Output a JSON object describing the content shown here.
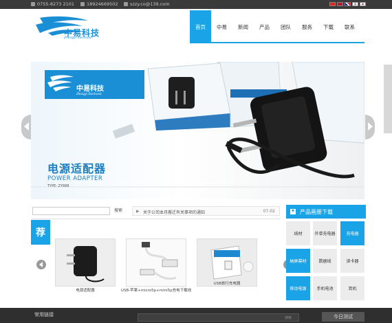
{
  "topbar": {
    "phone1": "0755-8273 2101",
    "phone2": "18924669502",
    "email": "szzy.co@139.com",
    "flags": [
      "cn-flag",
      "hk-flag",
      "uk-flag",
      "kr-flag",
      "jp-flag"
    ]
  },
  "logo": {
    "name": "中易科技",
    "sub": "Zhongyi Electronic"
  },
  "nav": {
    "items": [
      "首页",
      "中易",
      "新闻",
      "产品",
      "团队",
      "服务",
      "下载",
      "联系"
    ],
    "active_index": 0
  },
  "banner": {
    "logo_name": "中易科技",
    "logo_sub": "Zhongyi Electronic",
    "title": "电源适配器",
    "subtitle": "POWER ADAPTER",
    "type": "TYPE: ZY888"
  },
  "search": {
    "button": "搜索",
    "placeholder": ""
  },
  "news": {
    "text": "关于公司本月搬迁有关事项的通知",
    "date": "07-02"
  },
  "recommend": {
    "badge": "荐",
    "products": [
      {
        "label": "电源适配器"
      },
      {
        "label": "USB-苹果+micro5p+mini5p充电下载线"
      },
      {
        "label": "USB旅行充电器"
      }
    ]
  },
  "download": {
    "title": "产品画册下载",
    "categories": [
      {
        "label": "线材",
        "highlight": false
      },
      {
        "label": "外单充电器",
        "highlight": false
      },
      {
        "label": "充电器",
        "highlight": true
      },
      {
        "label": "納屏幕材",
        "highlight": true
      },
      {
        "label": "数据线",
        "highlight": false
      },
      {
        "label": "读卡器",
        "highlight": false
      },
      {
        "label": "移动电源",
        "highlight": true
      },
      {
        "label": "手机电池",
        "highlight": false
      },
      {
        "label": "耳机",
        "highlight": false
      }
    ]
  },
  "footer": {
    "links_label": "常用链接",
    "search_hint": "搜索",
    "button": "今日测试"
  },
  "colors": {
    "accent": "#1aa3e6",
    "dark": "#3a3a3a",
    "footer": "#2f2f2f"
  }
}
